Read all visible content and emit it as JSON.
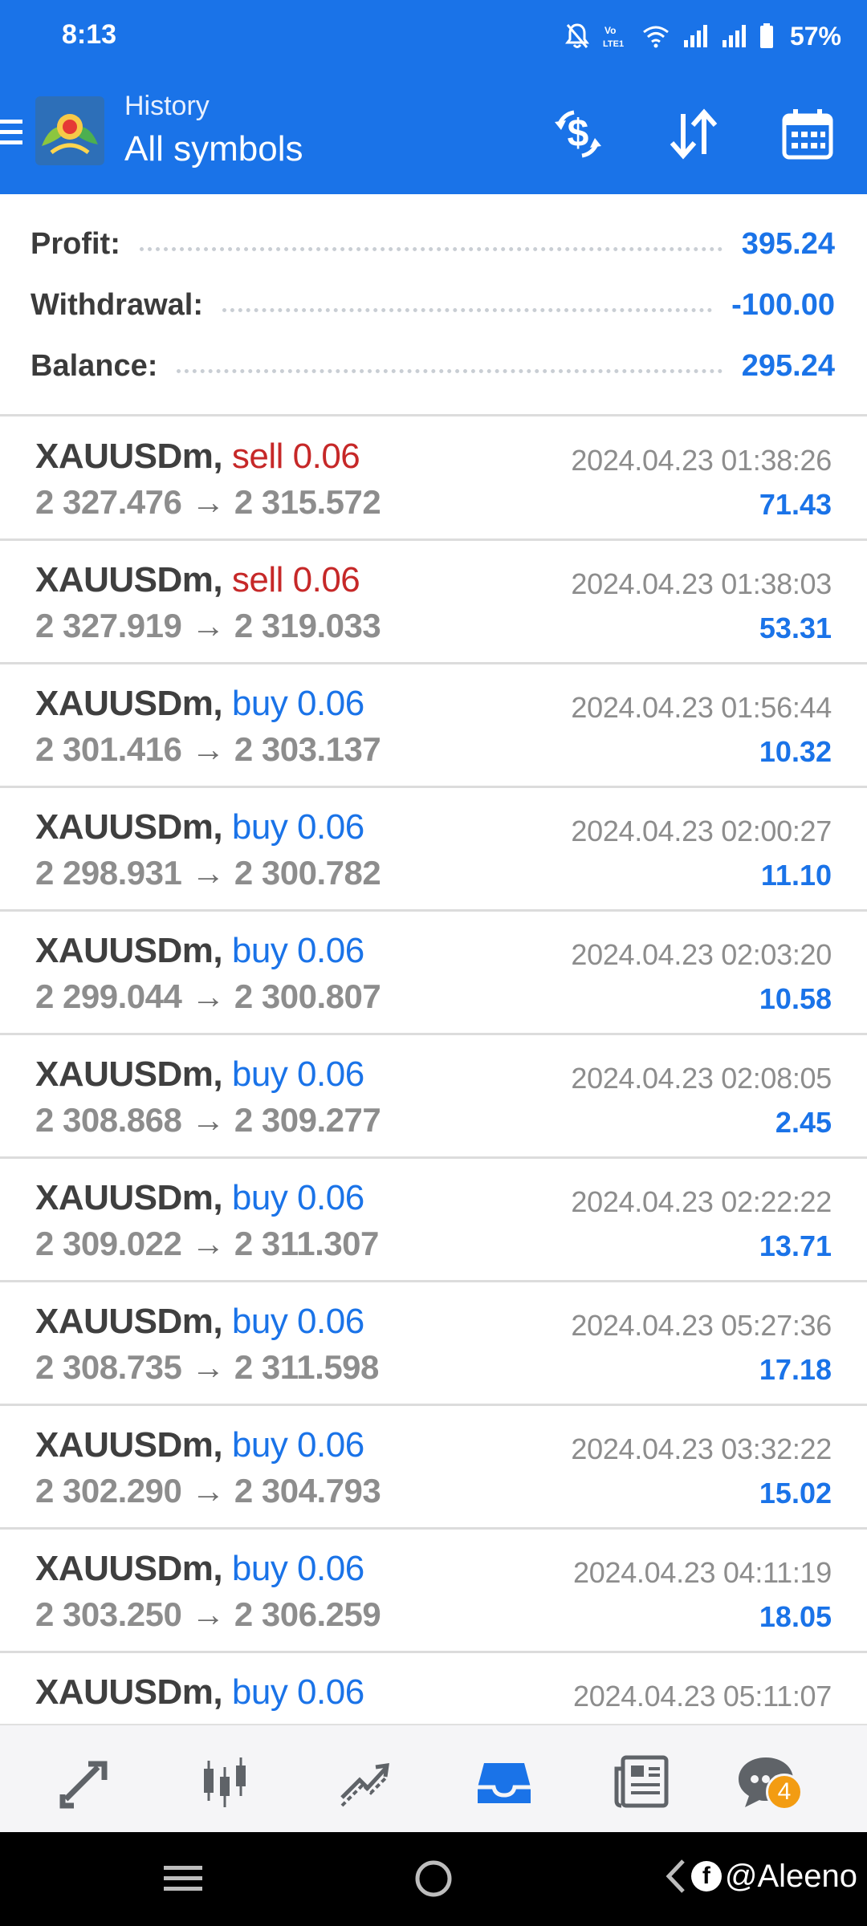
{
  "status_bar": {
    "time": "8:13",
    "battery": "57%"
  },
  "header": {
    "subtitle": "History",
    "title": "All symbols",
    "icons": [
      "menu-icon",
      "dollar-exchange-icon",
      "sort-icon",
      "calendar-icon"
    ]
  },
  "summary": {
    "profit_label": "Profit:",
    "profit_value": "395.24",
    "withdrawal_label": "Withdrawal:",
    "withdrawal_value": "-100.00",
    "balance_label": "Balance:",
    "balance_value": "295.24"
  },
  "deals": [
    {
      "symbol": "XAUUSDm,",
      "type": "sell 0.06",
      "side": "sell",
      "open": "2 327.476",
      "close": "2 315.572",
      "time": "2024.04.23 01:38:26",
      "profit": "71.43"
    },
    {
      "symbol": "XAUUSDm,",
      "type": "sell 0.06",
      "side": "sell",
      "open": "2 327.919",
      "close": "2 319.033",
      "time": "2024.04.23 01:38:03",
      "profit": "53.31"
    },
    {
      "symbol": "XAUUSDm,",
      "type": "buy 0.06",
      "side": "buy",
      "open": "2 301.416",
      "close": "2 303.137",
      "time": "2024.04.23 01:56:44",
      "profit": "10.32"
    },
    {
      "symbol": "XAUUSDm,",
      "type": "buy 0.06",
      "side": "buy",
      "open": "2 298.931",
      "close": "2 300.782",
      "time": "2024.04.23 02:00:27",
      "profit": "11.10"
    },
    {
      "symbol": "XAUUSDm,",
      "type": "buy 0.06",
      "side": "buy",
      "open": "2 299.044",
      "close": "2 300.807",
      "time": "2024.04.23 02:03:20",
      "profit": "10.58"
    },
    {
      "symbol": "XAUUSDm,",
      "type": "buy 0.06",
      "side": "buy",
      "open": "2 308.868",
      "close": "2 309.277",
      "time": "2024.04.23 02:08:05",
      "profit": "2.45"
    },
    {
      "symbol": "XAUUSDm,",
      "type": "buy 0.06",
      "side": "buy",
      "open": "2 309.022",
      "close": "2 311.307",
      "time": "2024.04.23 02:22:22",
      "profit": "13.71"
    },
    {
      "symbol": "XAUUSDm,",
      "type": "buy 0.06",
      "side": "buy",
      "open": "2 308.735",
      "close": "2 311.598",
      "time": "2024.04.23 05:27:36",
      "profit": "17.18"
    },
    {
      "symbol": "XAUUSDm,",
      "type": "buy 0.06",
      "side": "buy",
      "open": "2 302.290",
      "close": "2 304.793",
      "time": "2024.04.23 03:32:22",
      "profit": "15.02"
    },
    {
      "symbol": "XAUUSDm,",
      "type": "buy 0.06",
      "side": "buy",
      "open": "2 303.250",
      "close": "2 306.259",
      "time": "2024.04.23 04:11:19",
      "profit": "18.05"
    },
    {
      "symbol": "XAUUSDm,",
      "type": "buy 0.06",
      "side": "buy",
      "open": "",
      "close": "",
      "time": "2024.04.23 05:11:07",
      "profit": ""
    }
  ],
  "price_arrow": "→",
  "bottom_nav": {
    "items": [
      "quotes-icon",
      "chart-icon",
      "trade-icon",
      "history-icon",
      "news-icon",
      "chat-icon"
    ],
    "active": "history-icon",
    "chat_badge": "4"
  },
  "watermark": "@Aleeno",
  "colors": {
    "accent": "#1a73e8",
    "sell": "#c62828",
    "buy": "#1a73e8",
    "badge": "#f39c12"
  }
}
